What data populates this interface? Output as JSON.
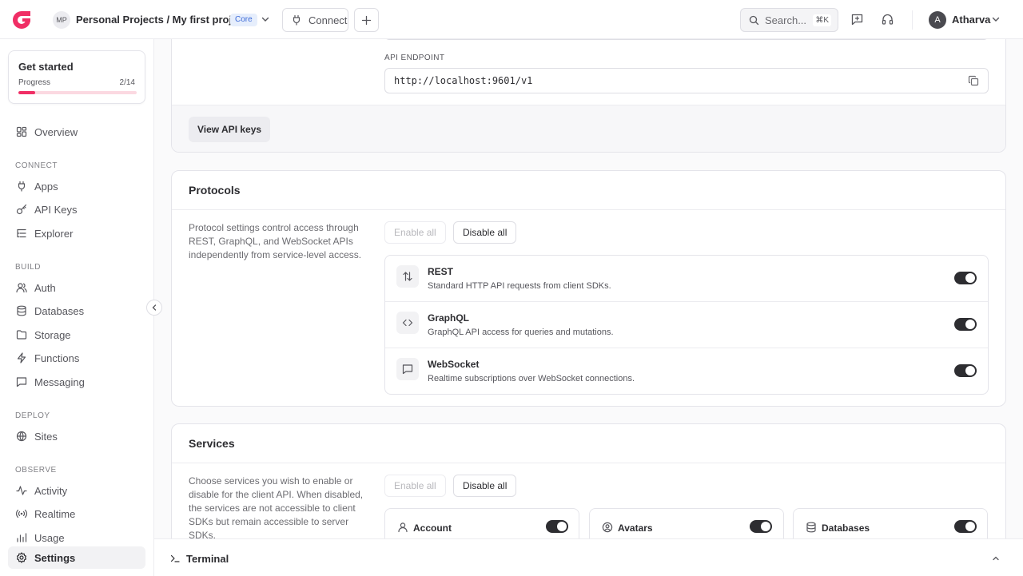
{
  "header": {
    "project_initials": "MP",
    "project_path": "Personal Projects / My first project",
    "plan_badge": "Core",
    "connect_label": "Connect",
    "search_placeholder": "Search...",
    "search_shortcut": "⌘K",
    "user_initial": "A",
    "user_name": "Atharva"
  },
  "sidebar": {
    "get_started": {
      "title": "Get started",
      "progress_label": "Progress",
      "progress_count": "2/14",
      "progress_fraction": 0.143
    },
    "overview": "Overview",
    "sections": {
      "connect": "CONNECT",
      "build": "BUILD",
      "deploy": "DEPLOY",
      "observe": "OBSERVE"
    },
    "items": {
      "apps": "Apps",
      "api_keys": "API Keys",
      "explorer": "Explorer",
      "auth": "Auth",
      "databases": "Databases",
      "storage": "Storage",
      "functions": "Functions",
      "messaging": "Messaging",
      "sites": "Sites",
      "activity": "Activity",
      "realtime": "Realtime",
      "usage": "Usage",
      "settings": "Settings"
    }
  },
  "api_card": {
    "endpoint_label": "API ENDPOINT",
    "endpoint_value": "http://localhost:9601/v1",
    "view_keys_label": "View API keys"
  },
  "protocols": {
    "title": "Protocols",
    "description": "Protocol settings control access through REST, GraphQL, and WebSocket APIs independently from service-level access.",
    "enable_all": "Enable all",
    "disable_all": "Disable all",
    "items": [
      {
        "name": "REST",
        "description": "Standard HTTP API requests from client SDKs.",
        "enabled": true,
        "icon": "arrows-up-down-icon"
      },
      {
        "name": "GraphQL",
        "description": "GraphQL API access for queries and mutations.",
        "enabled": true,
        "icon": "code-icon"
      },
      {
        "name": "WebSocket",
        "description": "Realtime subscriptions over WebSocket connections.",
        "enabled": true,
        "icon": "message-icon"
      }
    ]
  },
  "services": {
    "title": "Services",
    "description": "Choose services you wish to enable or disable for the client API. When disabled, the services are not accessible to client SDKs but remain accessible to server SDKs.",
    "enable_all": "Enable all",
    "disable_all": "Disable all",
    "items": [
      {
        "name": "Account",
        "enabled": true,
        "icon": "user-icon"
      },
      {
        "name": "Avatars",
        "enabled": true,
        "icon": "user-circle-icon"
      },
      {
        "name": "Databases",
        "enabled": true,
        "icon": "database-icon"
      }
    ]
  },
  "terminal": {
    "label": "Terminal"
  },
  "colors": {
    "accent": "#f02e65",
    "toggle_on": "#2d2d31",
    "badge_text": "#3f6cd8"
  }
}
